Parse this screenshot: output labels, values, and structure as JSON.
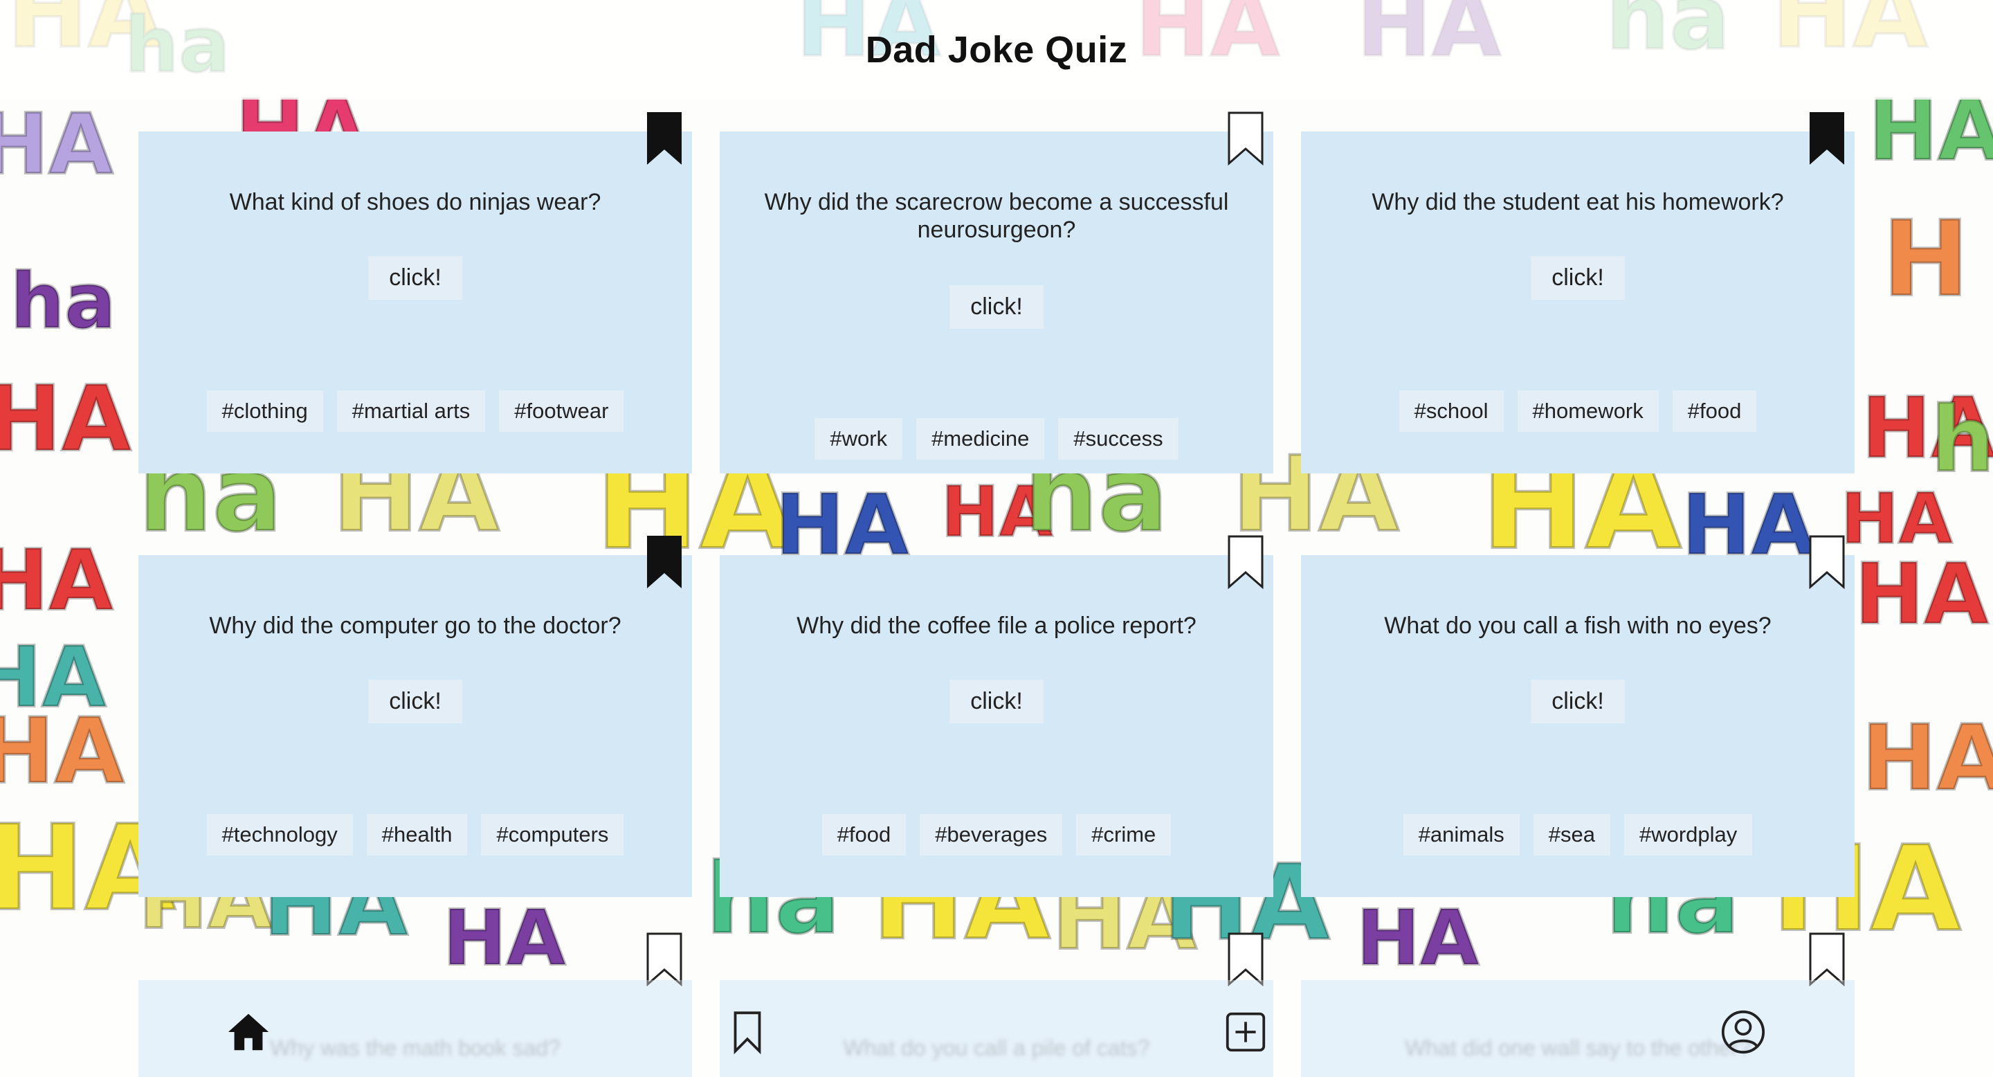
{
  "app": {
    "title": "Dad Joke Quiz"
  },
  "colors": {
    "card_bg": "#d5e8f6",
    "chip_bg": "#e4eef7",
    "text": "#222222"
  },
  "cards": [
    {
      "question": "What kind of shoes do ninjas wear?",
      "button": "click!",
      "tags": [
        "#clothing",
        "#martial arts",
        "#footwear"
      ],
      "bookmarked": true
    },
    {
      "question": "Why did the scarecrow become a successful neurosurgeon?",
      "button": "click!",
      "tags": [
        "#work",
        "#medicine",
        "#success"
      ],
      "bookmarked": false
    },
    {
      "question": "Why did the student eat his homework?",
      "button": "click!",
      "tags": [
        "#school",
        "#homework",
        "#food"
      ],
      "bookmarked": true
    },
    {
      "question": "Why did the computer go to the doctor?",
      "button": "click!",
      "tags": [
        "#technology",
        "#health",
        "#computers"
      ],
      "bookmarked": true
    },
    {
      "question": "Why did the coffee file a police report?",
      "button": "click!",
      "tags": [
        "#food",
        "#beverages",
        "#crime"
      ],
      "bookmarked": false
    },
    {
      "question": "What do you call a fish with no eyes?",
      "button": "click!",
      "tags": [
        "#animals",
        "#sea",
        "#wordplay"
      ],
      "bookmarked": false
    }
  ],
  "peek_cards": [
    {
      "question": "Why was the math book sad?",
      "bookmarked": false
    },
    {
      "question": "What do you call a pile of cats?",
      "bookmarked": false
    },
    {
      "question": "What did one wall say to the other?",
      "bookmarked": false
    }
  ],
  "bottom_nav": [
    {
      "icon": "home-icon",
      "label": "Home"
    },
    {
      "icon": "bookmark-icon",
      "label": "Saved"
    },
    {
      "icon": "add-icon",
      "label": "Add"
    },
    {
      "icon": "profile-icon",
      "label": "Profile"
    }
  ]
}
